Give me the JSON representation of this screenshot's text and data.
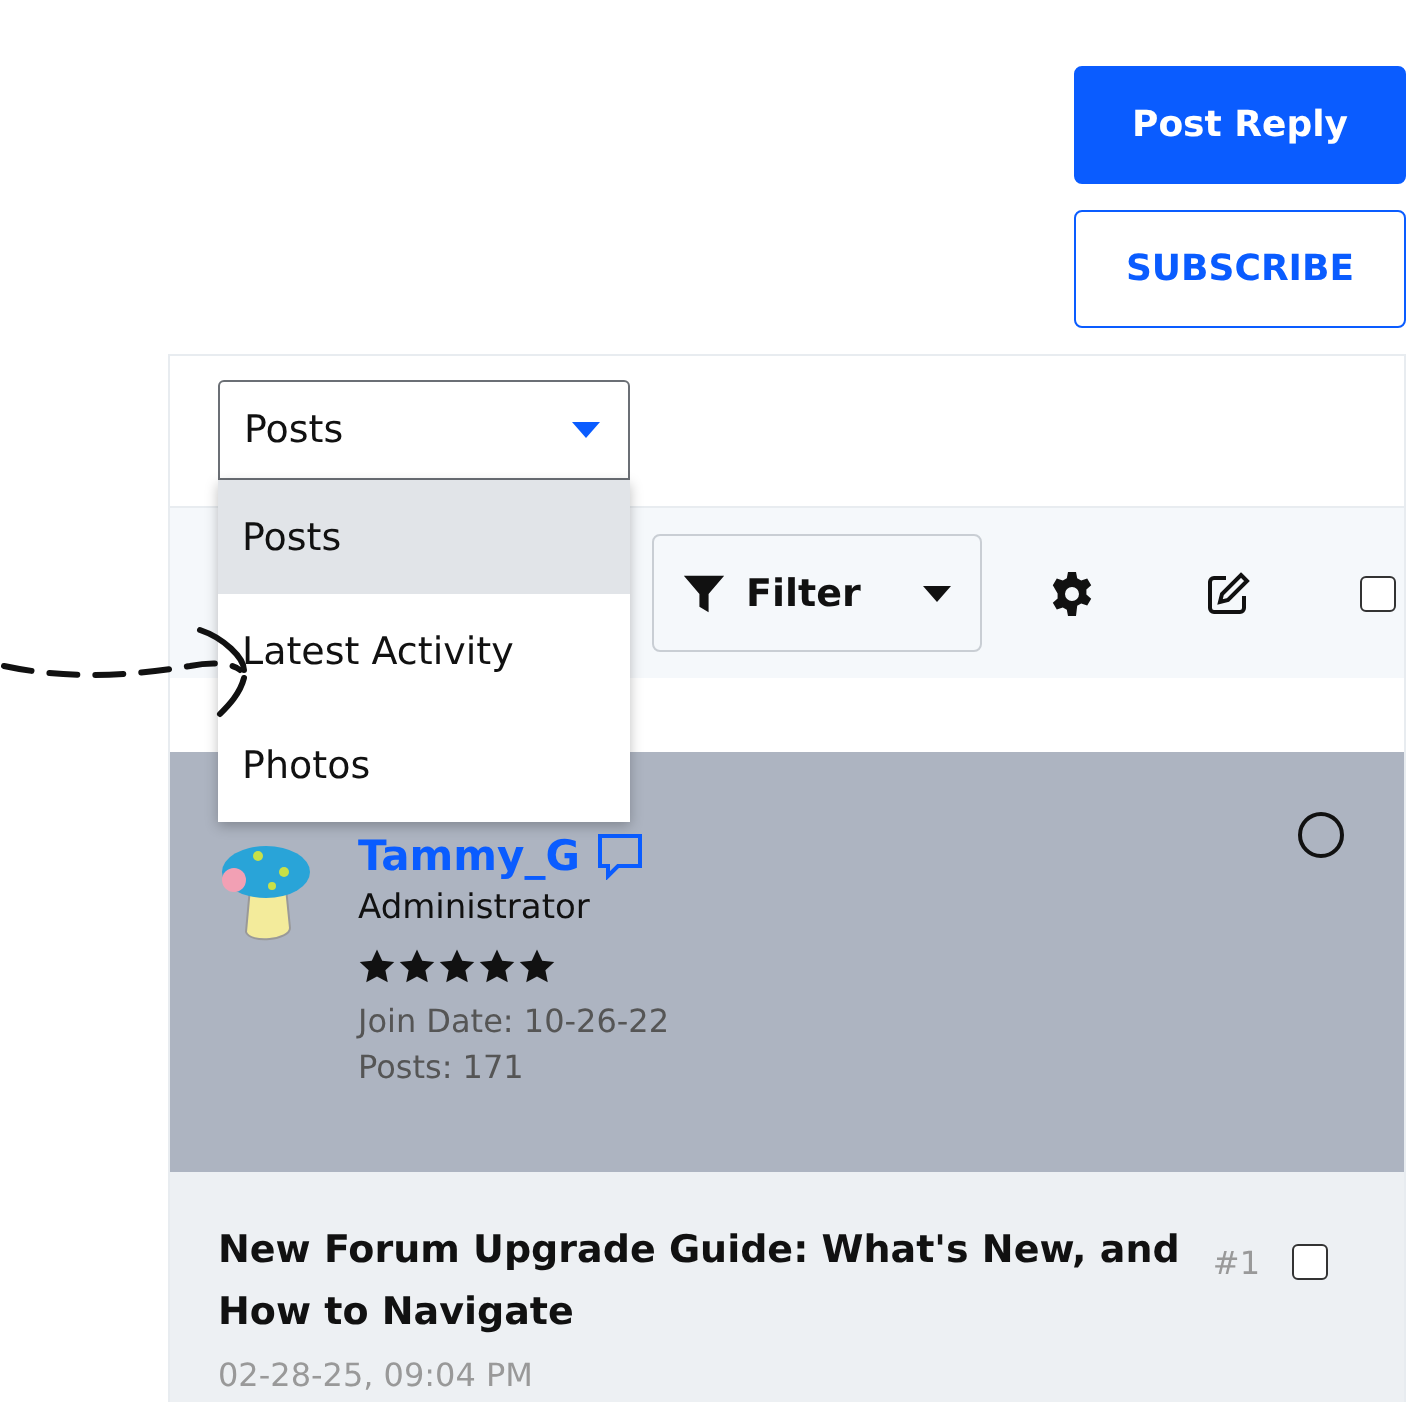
{
  "actions": [
    {
      "label": "Post Reply",
      "kind": "primary"
    },
    {
      "label": "SUBSCRIBE",
      "kind": "outline"
    }
  ],
  "view_select": {
    "value": "Posts",
    "expanded": true,
    "options": [
      {
        "label": "Posts",
        "selected": true
      },
      {
        "label": "Latest Activity",
        "selected": false
      },
      {
        "label": "Photos",
        "selected": false
      }
    ]
  },
  "toolbar": {
    "filter": {
      "label": "Filter"
    },
    "select_all": {
      "checked": false
    }
  },
  "post": {
    "author": "Tammy_G",
    "role": "Administrator",
    "stars": 5,
    "join_date": "Join Date: 10-26-22",
    "posts": "Posts: 171",
    "selected": false,
    "title": "New Forum Upgrade Guide: What's New, and How to Navigate",
    "number": "#1",
    "checked": false,
    "date": "02-28-25, 09:04 PM"
  }
}
